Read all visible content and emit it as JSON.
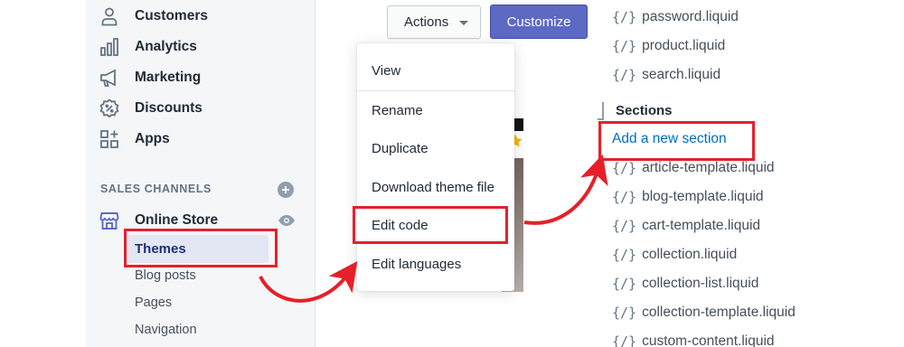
{
  "sidebar": {
    "items": [
      {
        "label": "Customers",
        "icon": "customers-icon"
      },
      {
        "label": "Analytics",
        "icon": "analytics-icon"
      },
      {
        "label": "Marketing",
        "icon": "marketing-icon"
      },
      {
        "label": "Discounts",
        "icon": "discounts-icon"
      },
      {
        "label": "Apps",
        "icon": "apps-icon"
      }
    ],
    "sales_channels_label": "SALES CHANNELS",
    "online_store": {
      "label": "Online Store",
      "icon": "store-icon"
    },
    "sub_items": [
      {
        "label": "Themes",
        "active": true
      },
      {
        "label": "Blog posts"
      },
      {
        "label": "Pages"
      },
      {
        "label": "Navigation"
      }
    ]
  },
  "toolbar": {
    "actions_label": "Actions",
    "customize_label": "Customize"
  },
  "dropdown": {
    "items": [
      "View",
      "Rename",
      "Duplicate",
      "Download theme file",
      "Edit code",
      "Edit languages"
    ]
  },
  "files": {
    "templates": [
      "password.liquid",
      "product.liquid",
      "search.liquid"
    ],
    "sections_title": "Sections",
    "add_section_label": "Add a new section",
    "sections": [
      "article-template.liquid",
      "blog-template.liquid",
      "cart-template.liquid",
      "collection.liquid",
      "collection-list.liquid",
      "collection-template.liquid",
      "custom-content.liquid"
    ],
    "file_icon_text": "{/}"
  },
  "colors": {
    "accent": "#5c6ac4",
    "highlight": "#e5202a",
    "link": "#006fbb",
    "active_nav": "#202e78"
  }
}
